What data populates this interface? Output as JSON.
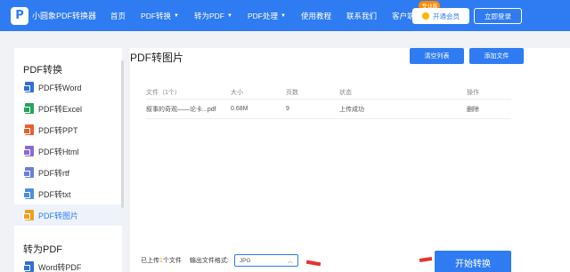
{
  "nav": {
    "logo_letter": "P",
    "logo_text": "小圆象PDF转换器",
    "items": [
      {
        "label": "首页",
        "caret": false
      },
      {
        "label": "PDF转换",
        "caret": true
      },
      {
        "label": "转为PDF",
        "caret": true
      },
      {
        "label": "PDF处理",
        "caret": true
      },
      {
        "label": "使用教程",
        "caret": false
      },
      {
        "label": "联系我们",
        "caret": false
      },
      {
        "label": "客户端下载",
        "caret": false
      }
    ],
    "pro_badge": "专业版",
    "vip_button": "开通会员",
    "login_button": "立即登录"
  },
  "sidebar": {
    "group1_title": "PDF转换",
    "items": [
      {
        "label": "PDF转Word",
        "icon": "word-file-icon"
      },
      {
        "label": "PDF转Excel",
        "icon": "excel-file-icon"
      },
      {
        "label": "PDF转PPT",
        "icon": "ppt-file-icon"
      },
      {
        "label": "PDF转Html",
        "icon": "html-file-icon"
      },
      {
        "label": "PDF转rtf",
        "icon": "rtf-file-icon"
      },
      {
        "label": "PDF转txt",
        "icon": "txt-file-icon"
      },
      {
        "label": "PDF转图片",
        "icon": "image-file-icon",
        "active": true
      }
    ],
    "group2_title": "转为PDF",
    "items2": [
      {
        "label": "Word转PDF",
        "icon": "word-file-icon"
      }
    ]
  },
  "main": {
    "title": "PDF转图片",
    "clear_button": "清空列表",
    "add_button": "添加文件",
    "table": {
      "headers": [
        "文件（1个）",
        "大小",
        "页数",
        "状态",
        "操作"
      ],
      "rows": [
        [
          "叙事的奇观——论卡...pdf",
          "0.68M",
          "9",
          "上传成功",
          "删除"
        ]
      ]
    },
    "uploaded_prefix": "已上传",
    "uploaded_count": "1",
    "uploaded_suffix": "个文件",
    "format_label": "输出文件格式:",
    "format_value": "JPG",
    "start_button": "开始转换"
  },
  "colors": {
    "primary": "#2f7bf2",
    "accent": "#ff9a00",
    "annotation_arrow": "#e8322c"
  }
}
